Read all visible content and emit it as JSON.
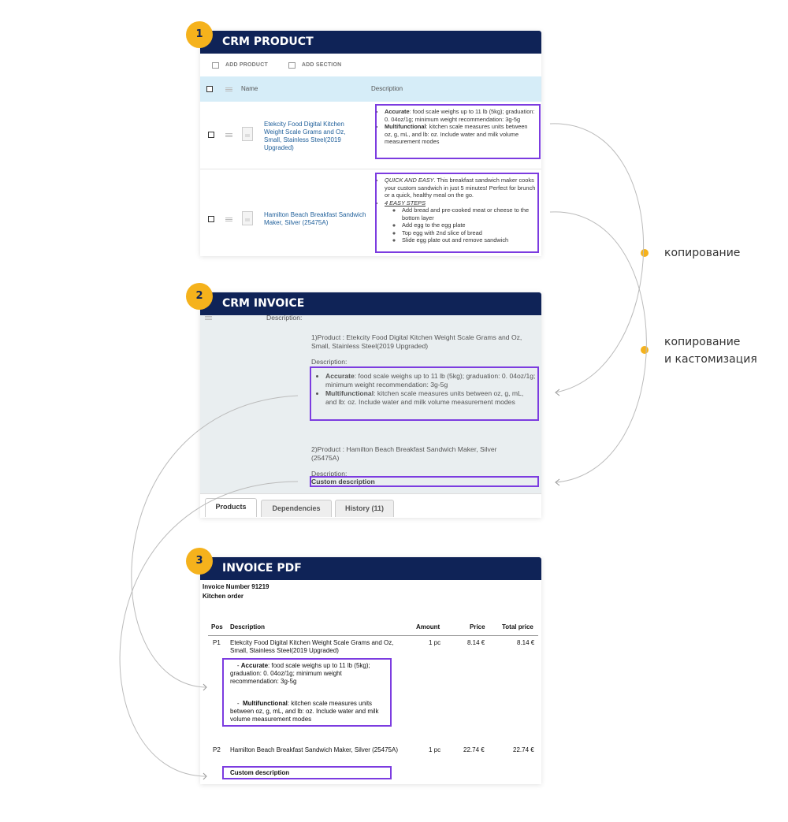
{
  "colors": {
    "header_bg": "#0f2357",
    "badge": "#f5b21c",
    "highlight": "#7c3ce0",
    "table_header": "#d6edf8",
    "link": "#1f5f9a"
  },
  "panel1": {
    "badge": "1",
    "title": "CRM PRODUCT",
    "toolbar": {
      "add_product": "ADD PRODUCT",
      "add_section": "ADD SECTION"
    },
    "columns": {
      "name": "Name",
      "description": "Description"
    },
    "rows": [
      {
        "name": "Etekcity Food Digital Kitchen Weight Scale Grams and Oz, Small, Stainless Steel(2019 Upgraded)",
        "bullets": [
          {
            "bold": "Accurate",
            "text": ": food scale weighs up to 11 lb (5kg); graduation: 0. 04oz/1g; minimum weight recommendation: 3g-5g"
          },
          {
            "bold": "Multifunctional",
            "text": ": kitchen scale measures units between oz, g, mL, and lb: oz. Include water and milk volume measurement modes"
          }
        ]
      },
      {
        "name": "Hamilton Beach Breakfast Sandwich Maker, Silver (25475A)",
        "bullet1": "QUICK AND EASY",
        "bullet1_rest": ". This breakfast sandwich maker cooks your custom sandwich in just 5 minutes! Perfect for brunch or a quick, healthy meal on the go.",
        "bullet2": "4 EASY STEPS",
        "steps": [
          "Add bread and pre-cooked meat or cheese to the bottom layer",
          "Add egg to the egg plate",
          "Top egg with 2nd slice of bread",
          "Slide egg plate out and remove sandwich"
        ]
      }
    ]
  },
  "panel2": {
    "badge": "2",
    "title": "CRM INVOICE",
    "desc_label_top": "Description:",
    "product1": "1)Product : Etekcity Food Digital Kitchen Weight Scale Grams and Oz, Small, Stainless Steel(2019 Upgraded)",
    "desc_label": "Description:",
    "bullets": [
      {
        "bold": "Accurate",
        "text": ": food scale weighs up to 11 lb (5kg); graduation: 0. 04oz/1g; minimum weight recommendation: 3g-5g"
      },
      {
        "bold": "Multifunctional",
        "text": ": kitchen scale measures units between oz, g, mL, and lb: oz. Include water and milk volume measurement modes"
      }
    ],
    "product2": "2)Product : Hamilton Beach Breakfast Sandwich Maker, Silver (25475A)",
    "desc_label2": "Description:",
    "custom": "Custom description",
    "tabs": [
      "Products",
      "Dependencies",
      "History (11)"
    ]
  },
  "panel3": {
    "badge": "3",
    "title": "INVOICE PDF",
    "invoice_number": "Invoice Number 91219",
    "subtitle": "Kitchen order",
    "columns": {
      "pos": "Pos",
      "description": "Description",
      "amount": "Amount",
      "price": "Price",
      "total": "Total price"
    },
    "items": [
      {
        "pos": "P1",
        "name": "Etekcity Food Digital Kitchen Weight Scale Grams and Oz, Small, Stainless Steel(2019 Upgraded)",
        "amount": "1 pc",
        "price": "8.14 €",
        "total": "8.14 €"
      },
      {
        "pos": "P2",
        "name": "Hamilton Beach Breakfast Sandwich Maker, Silver (25475A)",
        "amount": "1 pc",
        "price": "22.74 €",
        "total": "22.74 €"
      }
    ],
    "bullet1_bold": "Accurate",
    "bullet1_text": ": food scale weighs up to 11 lb (5kg); graduation: 0. 04oz/1g; minimum weight recommendation: 3g-5g",
    "bullet2_bold": "Multifunctional",
    "bullet2_text": ": kitchen scale measures units between oz, g, mL, and lb: oz. Include water and milk volume measurement modes",
    "custom": "Custom description"
  },
  "labels": {
    "copy": "копирование",
    "copy_custom_1": "копирование",
    "copy_custom_2": "и кастомизация"
  }
}
